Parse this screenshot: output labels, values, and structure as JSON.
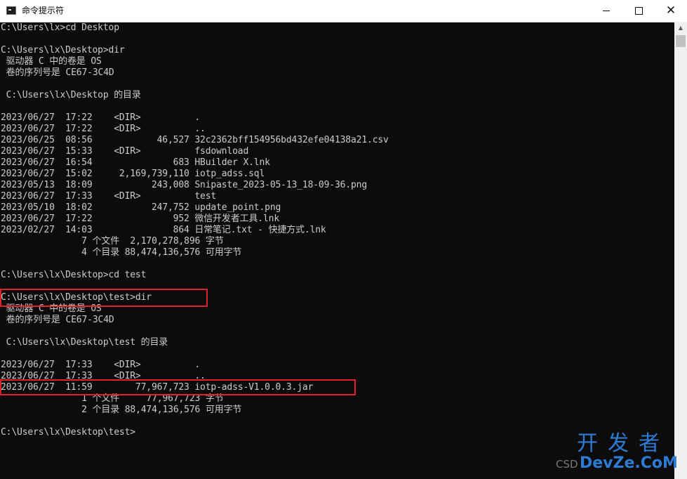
{
  "window": {
    "title": "命令提示符",
    "controls": {
      "minimize": "─",
      "maximize": "☐",
      "close": "✕"
    }
  },
  "console": {
    "lines": [
      "C:\\Users\\lx>cd Desktop",
      "",
      "C:\\Users\\lx\\Desktop>dir",
      " 驱动器 C 中的卷是 OS",
      " 卷的序列号是 CE67-3C4D",
      "",
      " C:\\Users\\lx\\Desktop 的目录",
      "",
      "2023/06/27  17:22    <DIR>          .",
      "2023/06/27  17:22    <DIR>          ..",
      "2023/06/25  08:56            46,527 32c2362bff154956bd432efe04138a21.csv",
      "2023/06/27  15:33    <DIR>          fsdownload",
      "2023/06/27  16:54               683 HBuilder X.lnk",
      "2023/06/27  15:02     2,169,739,110 iotp_adss.sql",
      "2023/05/13  18:09           243,008 Snipaste_2023-05-13_18-09-36.png",
      "2023/06/27  17:33    <DIR>          test",
      "2023/05/10  18:02           247,752 update_point.png",
      "2023/06/27  17:22               952 微信开发者工具.lnk",
      "2023/02/27  14:03               864 日常笔记.txt - 快捷方式.lnk",
      "               7 个文件  2,170,278,896 字节",
      "               4 个目录 88,474,136,576 可用字节",
      "",
      "C:\\Users\\lx\\Desktop>cd test",
      "",
      "C:\\Users\\lx\\Desktop\\test>dir",
      " 驱动器 C 中的卷是 OS",
      " 卷的序列号是 CE67-3C4D",
      "",
      " C:\\Users\\lx\\Desktop\\test 的目录",
      "",
      "2023/06/27  17:33    <DIR>          .",
      "2023/06/27  17:33    <DIR>          ..",
      "2023/06/27  11:59        77,967,723 iotp-adss-V1.0.0.3.jar",
      "               1 个文件     77,967,723 字节",
      "               2 个目录 88,474,136,576 可用字节",
      "",
      "C:\\Users\\lx\\Desktop\\test>"
    ]
  },
  "scrollbar": {
    "up_arrow": "▲"
  },
  "watermark": {
    "chinese": "开发者",
    "prefix": "CSD",
    "domain": "DevZe.CoM"
  },
  "colors": {
    "console_bg": "#0c0c0c",
    "console_text": "#cccccc",
    "highlight": "#e0232a",
    "watermark": "#2e7bd6"
  }
}
